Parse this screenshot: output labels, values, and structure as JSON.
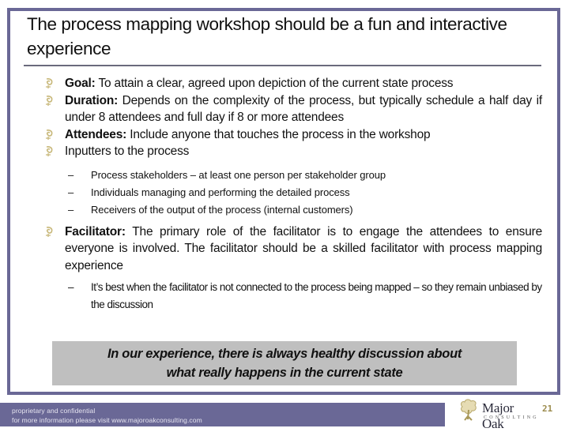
{
  "slide": {
    "title": "The process mapping workshop should be a fun and interactive experience",
    "bullets": [
      {
        "label": "Goal:",
        "text": " To attain a clear, agreed upon depiction of the current state process"
      },
      {
        "label": "Duration:",
        "text": " Depends on the complexity of the process, but typically schedule a half day if under 8 attendees and full day if 8 or more attendees"
      },
      {
        "label": "Attendees:",
        "text": " Include anyone that touches the process in the workshop"
      },
      {
        "label": "",
        "text": "Inputters to the process"
      },
      {
        "label": "Facilitator:",
        "text": " The primary role of the facilitator is to engage the attendees to ensure everyone is involved. The facilitator should be a skilled facilitator with process mapping experience"
      }
    ],
    "inputters_sub": [
      "Process stakeholders – at least one person per stakeholder group",
      "Individuals managing and performing the detailed process",
      "Receivers of the output of the process (internal customers)"
    ],
    "facilitator_sub": [
      "It’s best when the facilitator is not connected to the process being mapped – so they remain unbiased by the discussion"
    ],
    "dash": "–",
    "callout": {
      "line1": "In our experience, there is always healthy discussion about",
      "line2": "what really happens in the current state"
    }
  },
  "footer": {
    "line1": "proprietary and confidential",
    "line2": "for more information please visit www.majoroakconsulting.com",
    "logo_name": "Major Oak",
    "logo_sub": "CONSULTING",
    "page_number": "21"
  },
  "colors": {
    "frame": "#6a6896",
    "footer_bar": "#6a6896",
    "callout_bg": "#bfbfbf",
    "bullet": "#b8a86a",
    "page_number": "#9c8c4e"
  }
}
